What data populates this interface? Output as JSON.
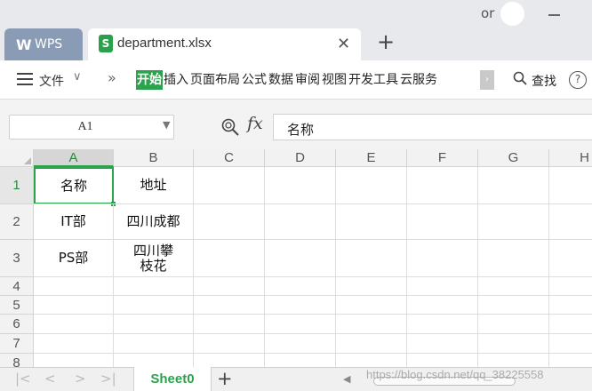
{
  "window": {
    "user_name": "or",
    "tabs": [
      {
        "label": "WPS",
        "icon": "wps-logo-icon"
      },
      {
        "label": "department.xlsx",
        "icon": "spreadsheet-doc-icon",
        "doc_icon_letter": "S"
      }
    ],
    "close_tab_glyph": "✕",
    "new_tab_glyph": "+"
  },
  "ribbon": {
    "file_label": "文件",
    "tabs": [
      {
        "label": "开始",
        "active": true
      },
      {
        "label": "插入"
      },
      {
        "label": "页面布局"
      },
      {
        "label": "公式"
      },
      {
        "label": "数据"
      },
      {
        "label": "审阅"
      },
      {
        "label": "视图"
      },
      {
        "label": "开发工具"
      },
      {
        "label": "云服务"
      }
    ],
    "search_label": "查找",
    "help_label": "?",
    "more_glyph": "›",
    "overflow_glyph": "»"
  },
  "formula_bar": {
    "cell_ref": "A1",
    "fx_label": "fx",
    "value": "名称"
  },
  "grid": {
    "columns": [
      "A",
      "B",
      "C",
      "D",
      "E",
      "F",
      "G",
      "H"
    ],
    "active_column": "A",
    "rows": [
      "1",
      "2",
      "3",
      "4",
      "5",
      "6",
      "7",
      "8"
    ],
    "active_row": "1",
    "cells": {
      "A1": "名称",
      "B1": "地址",
      "A2": "IT部",
      "B2": "四川成都",
      "A3": "PS部",
      "B3": "四川攀枝花"
    }
  },
  "sheets": {
    "tabs": [
      "Sheet0"
    ],
    "active": "Sheet0",
    "add_glyph": "+"
  },
  "watermark": "https://blog.csdn.net/qq_38225558",
  "colors": {
    "accent": "#2ba24c",
    "wps_tab": "#8a9bb5",
    "chrome": "#e7e9ec"
  }
}
